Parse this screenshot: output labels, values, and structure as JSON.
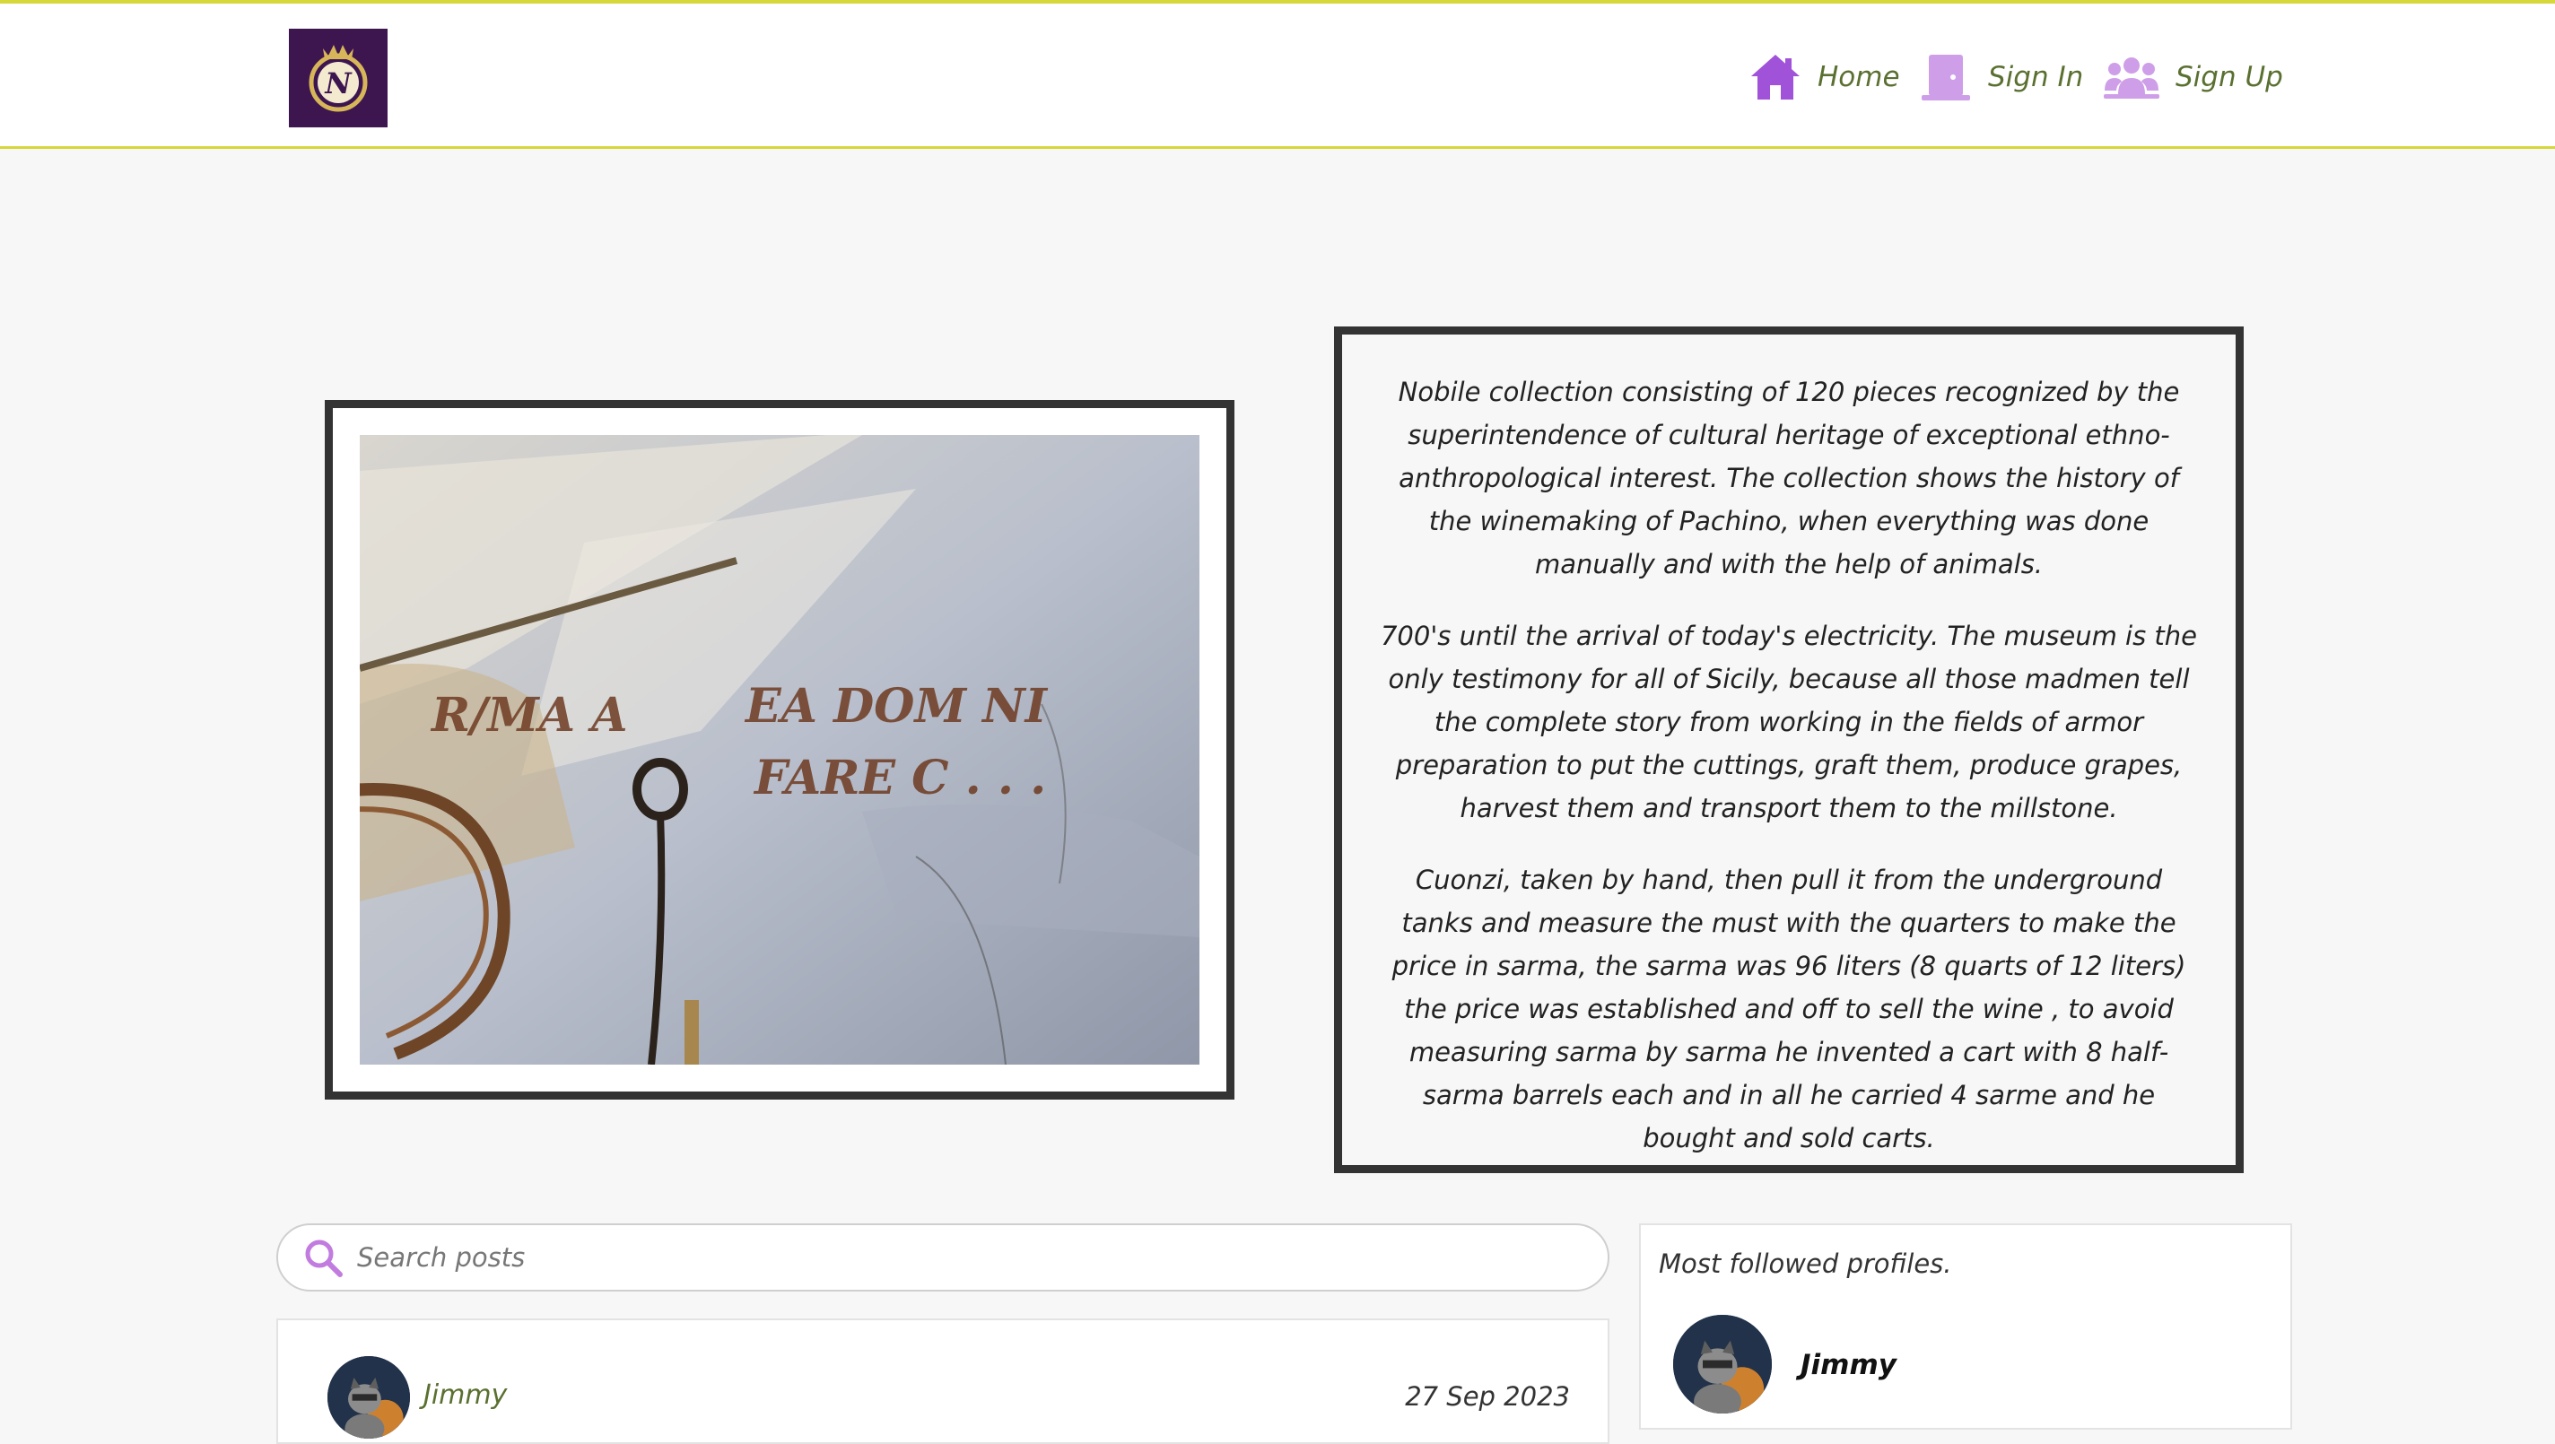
{
  "nav": {
    "logo_letter": "N",
    "home_label": "Home",
    "signin_label": "Sign In",
    "signup_label": "Sign Up",
    "link_color": "#5a7030",
    "icon_color": "#a052d8"
  },
  "hero": {
    "paragraphs": [
      "Nobile collection consisting of 120 pieces recognized by the superintendence of cultural heritage of exceptional ethno-anthropological interest. The collection shows the history of the winemaking of Pachino, when everything was done manually and with the help of animals.",
      "700's until the arrival of today's electricity. The museum is the only testimony for all of Sicily, because all those madmen tell the complete story from working in the fields of armor preparation to put the cuttings, graft them, produce grapes, harvest them and transport them to the millstone.",
      "Cuonzi, taken by hand, then pull it from the underground tanks and measure the must with the quarters to make the price in sarma, the sarma was 96 liters (8 quarts of 12 liters) the price was established and off to sell the wine , to avoid measuring sarma by sarma he invented a cart with 8 half-sarma barrels each and in all he carried 4 sarme and he bought and sold carts."
    ]
  },
  "search": {
    "placeholder": "Search posts"
  },
  "post": {
    "author": "Jimmy",
    "date": "27 Sep 2023"
  },
  "sidebar": {
    "title": "Most followed profiles.",
    "profiles": [
      {
        "name": "Jimmy"
      }
    ]
  },
  "colors": {
    "accent_border": "#d6d73a",
    "frame": "#333333",
    "background": "#f7f7f7",
    "logo_bg": "#3d1650"
  }
}
